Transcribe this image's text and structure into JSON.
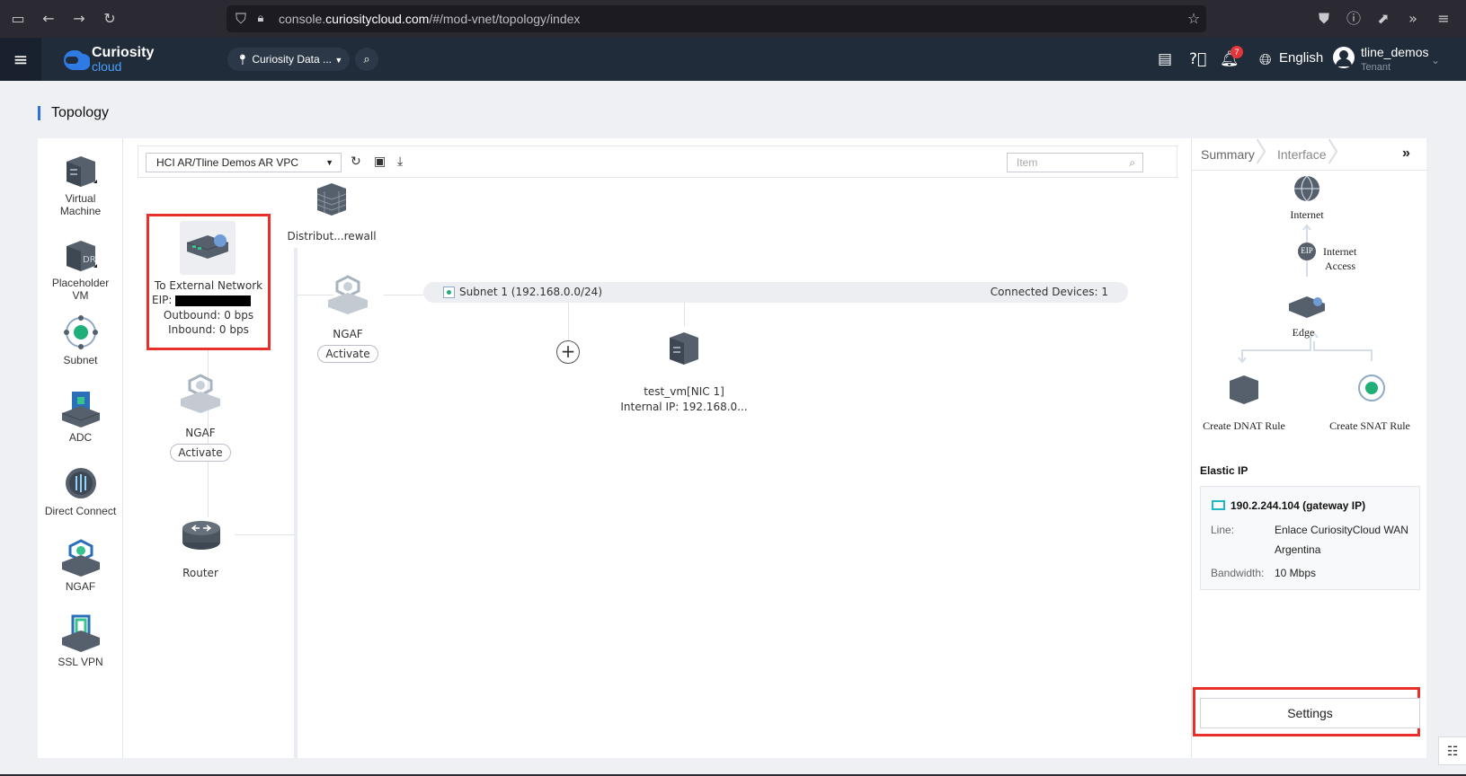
{
  "browser": {
    "url_prefix": "console.",
    "url_domain": "curiositycloud.com",
    "url_path": "/#/mod-vnet/topology/index"
  },
  "header": {
    "logo_line1": "Curiosity",
    "logo_line2": "cloud",
    "region": "Curiosity Data ...",
    "notification_count": "7",
    "language": "English",
    "username": "tline_demos",
    "role": "Tenant"
  },
  "page": {
    "title": "Topology"
  },
  "palette": [
    {
      "label1": "Virtual",
      "label2": "Machine"
    },
    {
      "label1": "Placeholder",
      "label2": "VM"
    },
    {
      "label1": "Subnet",
      "label2": ""
    },
    {
      "label1": "ADC",
      "label2": ""
    },
    {
      "label1": "Direct Connect",
      "label2": ""
    },
    {
      "label1": "NGAF",
      "label2": ""
    },
    {
      "label1": "SSL VPN",
      "label2": ""
    }
  ],
  "toolbar": {
    "vpc": "HCI AR/Tline Demos AR VPC",
    "search_placeholder": "Item"
  },
  "topology": {
    "external": {
      "title": "To External Network",
      "eip_label": "EIP:",
      "outbound": "Outbound: 0 bps",
      "inbound": "Inbound: 0 bps"
    },
    "ngaf_left": {
      "label": "NGAF",
      "action": "Activate"
    },
    "router": {
      "label": "Router"
    },
    "firewall": {
      "label": "Distribut...rewall"
    },
    "ngaf_mid": {
      "label": "NGAF",
      "action": "Activate"
    },
    "subnet": {
      "name": "Subnet 1 (192.168.0.0/24)",
      "devices": "Connected Devices: 1"
    },
    "vm": {
      "name": "test_vm[NIC 1]",
      "ip": "Internal IP: 192.168.0..."
    }
  },
  "panel": {
    "tabs": [
      "Summary",
      "Interface"
    ],
    "diagram": {
      "internet": "Internet",
      "eip_tag": "EIP",
      "access1": "Internet",
      "access2": "Access",
      "edge": "Edge",
      "dnat": "Create DNAT Rule",
      "snat": "Create SNAT Rule"
    },
    "elastic_ip": {
      "title": "Elastic IP",
      "ip": "190.2.244.104 (gateway IP)",
      "line_key": "Line:",
      "line_value1": "Enlace CuriosityCloud WAN",
      "line_value2": "Argentina",
      "bandwidth_key": "Bandwidth:",
      "bandwidth_value": "10 Mbps"
    },
    "settings": "Settings"
  }
}
